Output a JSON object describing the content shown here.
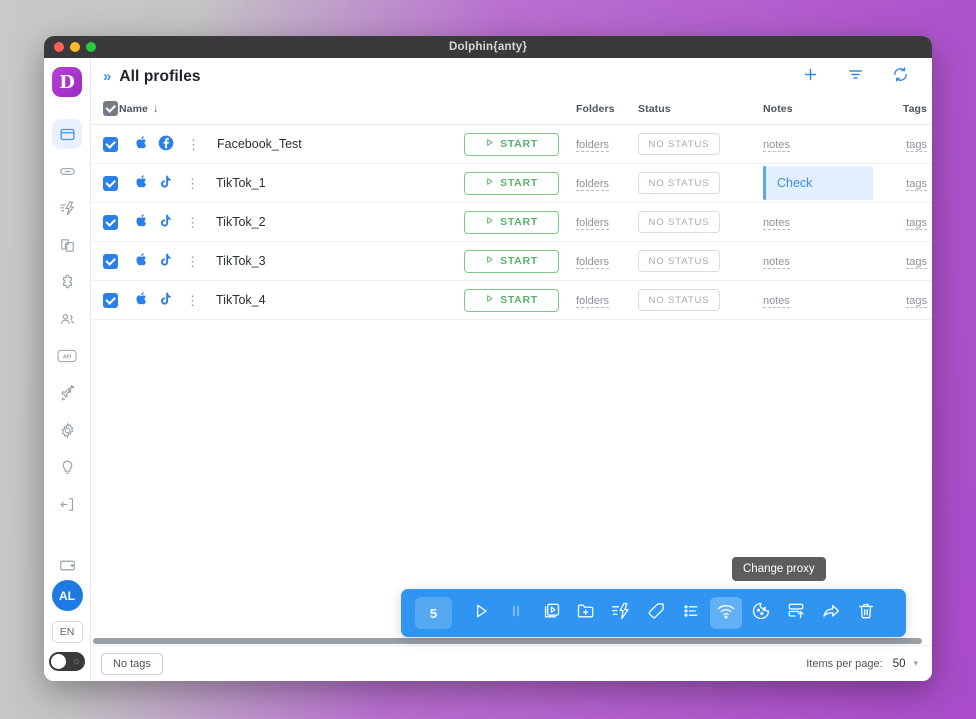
{
  "window": {
    "title": "Dolphin{anty}"
  },
  "sidebar": {
    "logo_letter": "D",
    "items": [
      {
        "icon": "browser-profiles-icon",
        "name": "sidebar-item-profiles",
        "active": true
      },
      {
        "icon": "proxy-link-icon",
        "name": "sidebar-item-proxies",
        "active": false
      },
      {
        "icon": "automation-icon",
        "name": "sidebar-item-automation",
        "active": false
      },
      {
        "icon": "duplicate-icon",
        "name": "sidebar-item-duplicates",
        "active": false
      },
      {
        "icon": "extension-puzzle-icon",
        "name": "sidebar-item-extensions",
        "active": false
      },
      {
        "icon": "team-users-icon",
        "name": "sidebar-item-team",
        "active": false
      },
      {
        "icon": "api-icon",
        "name": "sidebar-item-api",
        "active": false
      },
      {
        "icon": "rocket-icon",
        "name": "sidebar-item-launch",
        "active": false
      },
      {
        "icon": "gear-icon",
        "name": "sidebar-item-settings",
        "active": false
      },
      {
        "icon": "lightbulb-icon",
        "name": "sidebar-item-tips",
        "active": false
      },
      {
        "icon": "logout-icon",
        "name": "sidebar-item-logout",
        "active": false
      },
      {
        "icon": "card-export-icon",
        "name": "sidebar-item-billing",
        "active": false
      }
    ],
    "avatar_initials": "AL",
    "language": "EN"
  },
  "header": {
    "breadcrumb_chevron": "»",
    "title": "All profiles",
    "actions": [
      {
        "name": "add-profile-button",
        "icon": "plus-icon"
      },
      {
        "name": "filter-button",
        "icon": "filter-icon"
      },
      {
        "name": "refresh-button",
        "icon": "refresh-icon"
      }
    ]
  },
  "table": {
    "columns": {
      "name": "Name",
      "sort_arrow": "↓",
      "folders": "Folders",
      "status": "Status",
      "notes": "Notes",
      "tags": "Tags"
    },
    "start_label": "START",
    "rows": [
      {
        "name": "Facebook_Test",
        "checked": true,
        "platform_os": "apple-icon",
        "platform_app": "facebook-icon",
        "folders": "folders",
        "status": "NO STATUS",
        "notes": "notes",
        "notes_highlighted": false,
        "tags": "tags"
      },
      {
        "name": "TikTok_1",
        "checked": true,
        "platform_os": "apple-icon",
        "platform_app": "tiktok-icon",
        "folders": "folders",
        "status": "NO STATUS",
        "notes": "Check",
        "notes_highlighted": true,
        "tags": "tags"
      },
      {
        "name": "TikTok_2",
        "checked": true,
        "platform_os": "apple-icon",
        "platform_app": "tiktok-icon",
        "folders": "folders",
        "status": "NO STATUS",
        "notes": "notes",
        "notes_highlighted": false,
        "tags": "tags"
      },
      {
        "name": "TikTok_3",
        "checked": true,
        "platform_os": "apple-icon",
        "platform_app": "tiktok-icon",
        "folders": "folders",
        "status": "NO STATUS",
        "notes": "notes",
        "notes_highlighted": false,
        "tags": "tags"
      },
      {
        "name": "TikTok_4",
        "checked": true,
        "platform_os": "apple-icon",
        "platform_app": "tiktok-icon",
        "folders": "folders",
        "status": "NO STATUS",
        "notes": "notes",
        "notes_highlighted": false,
        "tags": "tags"
      }
    ]
  },
  "action_toolbar": {
    "selected_count": "5",
    "tooltip": "Change proxy",
    "buttons": [
      {
        "name": "start-selected-button",
        "icon": "play-icon",
        "active": false,
        "dim": false
      },
      {
        "name": "stop-selected-button",
        "icon": "pause-icon",
        "active": false,
        "dim": true
      },
      {
        "name": "clone-profiles-button",
        "icon": "duplicate-window-icon",
        "active": false,
        "dim": false
      },
      {
        "name": "move-to-folder-button",
        "icon": "folder-plus-icon",
        "active": false,
        "dim": false
      },
      {
        "name": "run-automation-button",
        "icon": "automation-bolt-icon",
        "active": false,
        "dim": false
      },
      {
        "name": "add-tag-button",
        "icon": "tag-icon",
        "active": false,
        "dim": false
      },
      {
        "name": "change-status-button",
        "icon": "list-icon",
        "active": false,
        "dim": false
      },
      {
        "name": "change-proxy-button",
        "icon": "wifi-proxy-icon",
        "active": true,
        "dim": false
      },
      {
        "name": "clear-cookies-button",
        "icon": "cookie-icon",
        "active": false,
        "dim": false
      },
      {
        "name": "export-profiles-button",
        "icon": "server-upload-icon",
        "active": false,
        "dim": false
      },
      {
        "name": "share-profiles-button",
        "icon": "share-arrow-icon",
        "active": false,
        "dim": false
      },
      {
        "name": "delete-profiles-button",
        "icon": "trash-icon",
        "active": false,
        "dim": false
      }
    ]
  },
  "footer": {
    "no_tags_label": "No tags",
    "items_per_page_label": "Items per page:",
    "items_per_page_value": "50",
    "caret": "▾"
  },
  "colors": {
    "accent_blue": "#2f95f0",
    "brand_purple": "#b83fd4",
    "start_green": "#59b26a",
    "note_highlight": "#e2effc"
  }
}
